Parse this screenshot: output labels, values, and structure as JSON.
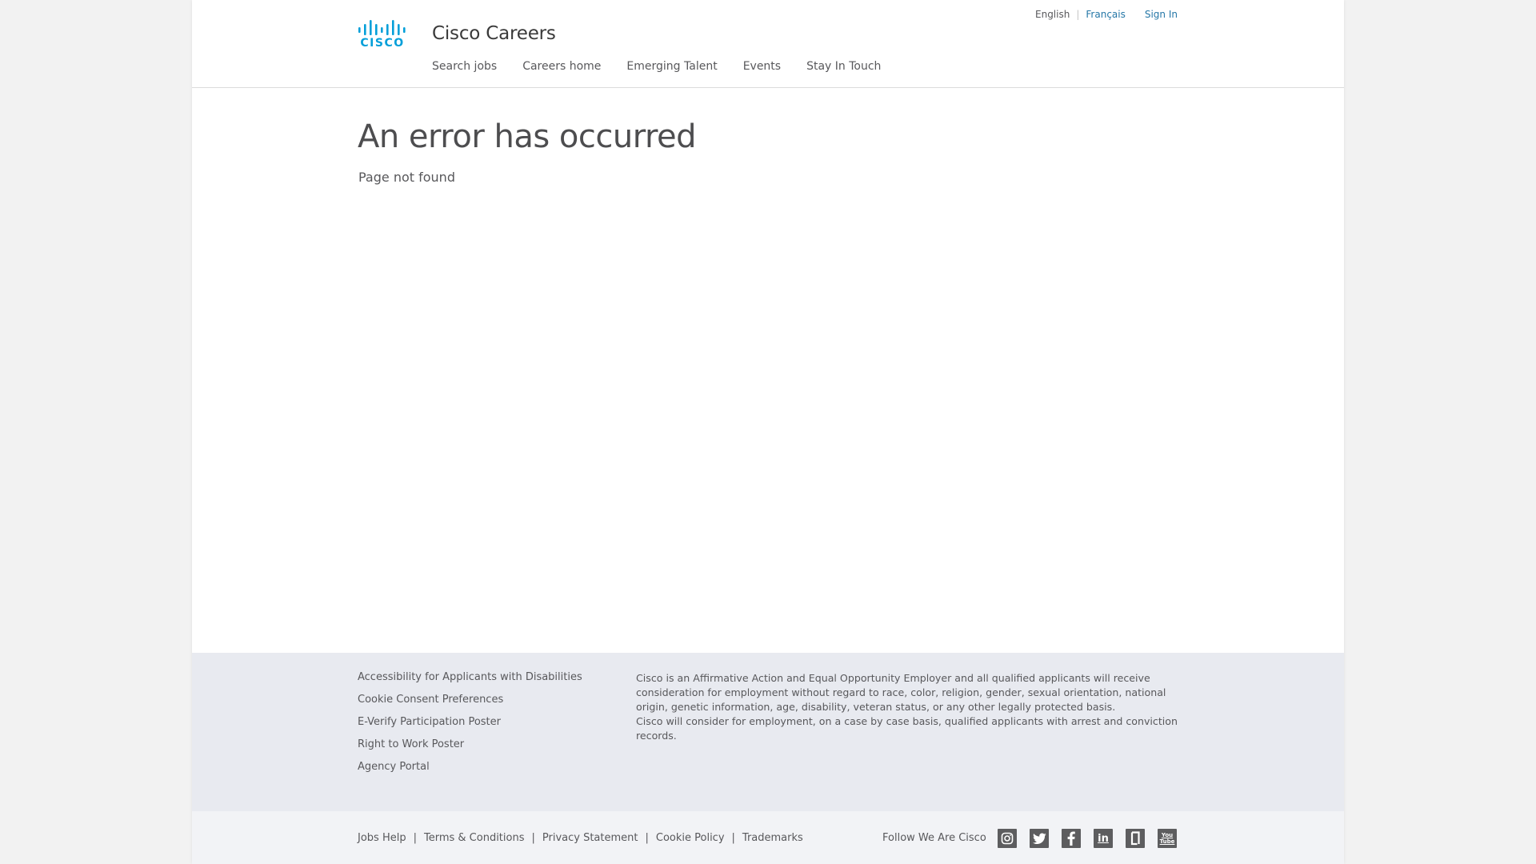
{
  "header": {
    "site_title": "Cisco Careers",
    "logo_text": "CISCO",
    "brand_color": "#049fd9",
    "top_links": {
      "language_current": "English",
      "language_alt": "Français",
      "sign_in": "Sign In"
    },
    "nav": [
      {
        "label": "Search jobs"
      },
      {
        "label": "Careers home"
      },
      {
        "label": "Emerging Talent"
      },
      {
        "label": "Events"
      },
      {
        "label": "Stay In Touch"
      }
    ]
  },
  "main": {
    "title": "An error has occurred",
    "subtitle": "Page not found"
  },
  "footer": {
    "links": [
      {
        "label": "Accessibility for Applicants with Disabilities"
      },
      {
        "label": "Cookie Consent Preferences"
      },
      {
        "label": "E-Verify Participation Poster"
      },
      {
        "label": "Right to Work Poster"
      },
      {
        "label": "Agency Portal"
      }
    ],
    "eeo_statement": "Cisco is an Affirmative Action and Equal Opportunity Employer and all qualified applicants will receive consideration for employment without regard to race, color, religion, gender, sexual orientation, national origin, genetic information, age, disability, veteran status, or any other legally protected basis.",
    "eeo_statement_2": "Cisco will consider for employment, on a case by case basis, qualified applicants with arrest and conviction records.",
    "bottom_links": [
      {
        "label": "Jobs Help"
      },
      {
        "label": "Terms & Conditions"
      },
      {
        "label": "Privacy Statement"
      },
      {
        "label": "Cookie Policy"
      },
      {
        "label": "Trademarks"
      }
    ],
    "bottom_separator": "|",
    "follow_text": "Follow We Are Cisco",
    "social": [
      {
        "icon": "instagram-icon"
      },
      {
        "icon": "twitter-icon"
      },
      {
        "icon": "facebook-icon"
      },
      {
        "icon": "linkedin-icon",
        "text": "in"
      },
      {
        "icon": "glassdoor-icon"
      },
      {
        "icon": "youtube-icon",
        "text": "You Tube"
      }
    ]
  }
}
